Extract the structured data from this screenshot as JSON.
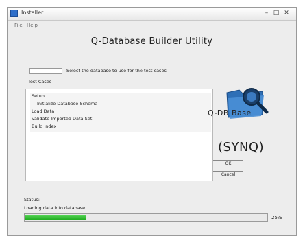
{
  "window": {
    "title": "Installer",
    "controls": {
      "minimize": "–",
      "maximize": "□",
      "close": "✕"
    }
  },
  "menu": {
    "items": [
      "File",
      "Help"
    ]
  },
  "heading": "Q-Database Builder Utility",
  "selector": {
    "value": "",
    "caption": "Select the database to use for the test cases"
  },
  "list": {
    "label": "Test Cases",
    "rows": [
      "Setup",
      "Initialize Database Schema",
      "Load Data",
      "Validate Imported Data Set",
      "Build Index"
    ]
  },
  "logos": {
    "primary_text": "Q-DB Base",
    "secondary_text": "(SYNQ)"
  },
  "buttons": {
    "ok": "OK",
    "cancel": "Cancel"
  },
  "status": {
    "label": "Status:",
    "text": "Loading data into database..."
  },
  "progress": {
    "value": 0.25,
    "label": "25%",
    "color": "#22b022"
  },
  "colors": {
    "accent": "#2f6fc9",
    "progress": "#22b022"
  },
  "icons": {
    "app": "app-icon",
    "magnifier": "magnifier-folder-icon"
  }
}
